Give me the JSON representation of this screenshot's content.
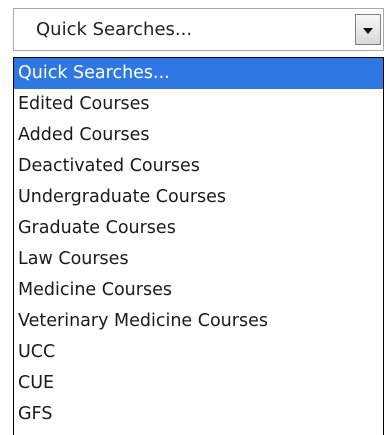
{
  "select": {
    "value": "Quick Searches...",
    "arrow_icon": "chevron-down-icon"
  },
  "colors": {
    "highlight": "#2f78e3",
    "highlight_text": "#ffffff"
  },
  "options": [
    {
      "label": "Quick Searches...",
      "selected": true
    },
    {
      "label": "Edited Courses",
      "selected": false
    },
    {
      "label": "Added Courses",
      "selected": false
    },
    {
      "label": "Deactivated Courses",
      "selected": false
    },
    {
      "label": "Undergraduate Courses",
      "selected": false
    },
    {
      "label": "Graduate Courses",
      "selected": false
    },
    {
      "label": "Law Courses",
      "selected": false
    },
    {
      "label": "Medicine Courses",
      "selected": false
    },
    {
      "label": "Veterinary Medicine Courses",
      "selected": false
    },
    {
      "label": "UCC",
      "selected": false
    },
    {
      "label": "CUE",
      "selected": false
    },
    {
      "label": "GFS",
      "selected": false
    }
  ]
}
